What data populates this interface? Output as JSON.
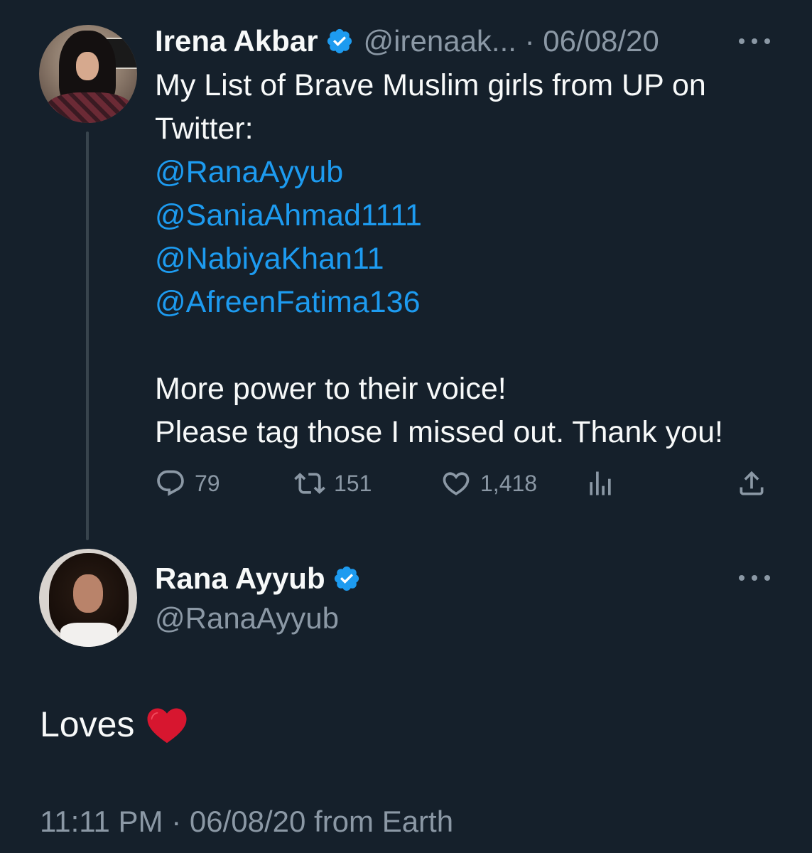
{
  "parent_tweet": {
    "author_name": "Irena Akbar",
    "handle_and_date": "@irenaak... · 06/08/20",
    "verified_icon": "verified-badge-icon",
    "text_lines": [
      "My List of Brave Muslim girls from UP on",
      "Twitter:"
    ],
    "mentions": [
      "@RanaAyyub",
      "@SaniaAhmad1111",
      "@NabiyaKhan11",
      "@AfreenFatima136"
    ],
    "closing_lines": [
      "More power to their voice!",
      "Please tag those I missed out. Thank you!"
    ],
    "actions": {
      "replies": "79",
      "retweets": "151",
      "likes": "1,418"
    }
  },
  "reply_tweet": {
    "author_name": "Rana Ayyub",
    "handle": "@RanaAyyub",
    "verified_icon": "verified-badge-icon",
    "text": "Loves",
    "emoji": "red-heart-emoji",
    "meta": "11:11 PM · 06/08/20 from Earth"
  },
  "colors": {
    "background": "#15202b",
    "text_primary": "#f7f9f9",
    "text_secondary": "#8b98a5",
    "link": "#1d9bf0",
    "verified": "#1d9bf0",
    "thread_line": "#38444d",
    "heart": "#d7162f"
  }
}
